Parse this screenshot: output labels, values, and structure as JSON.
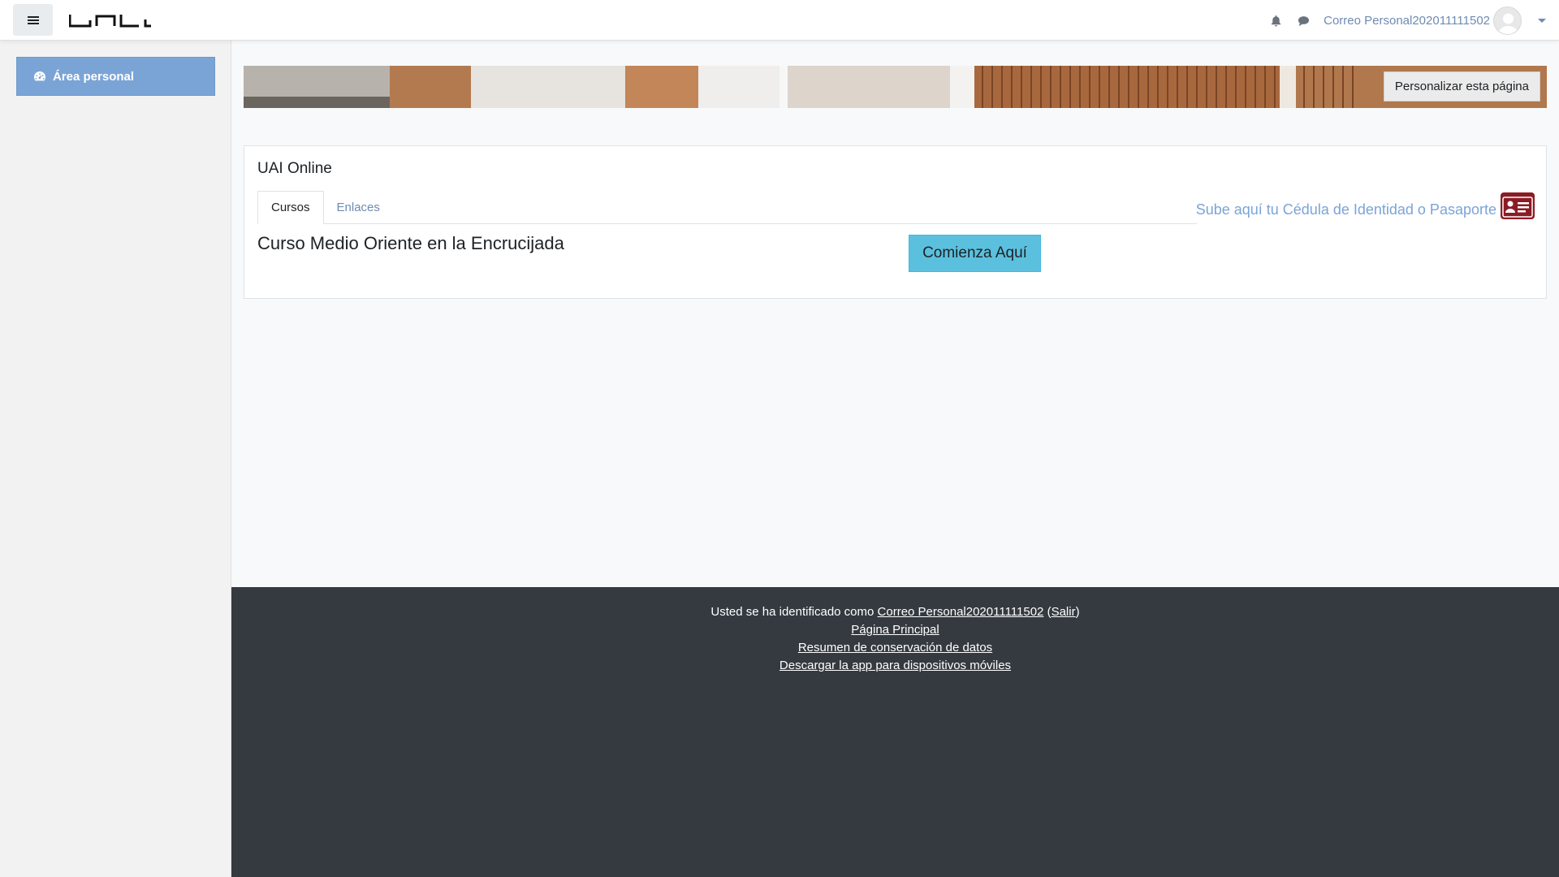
{
  "navbar": {
    "menu_label": "Menu",
    "notifications_icon": "bell-icon",
    "messages_icon": "comment-icon",
    "user_name": "Correo Personal202011111502"
  },
  "sidebar": {
    "items": [
      {
        "label": "Área personal",
        "icon": "dashboard-icon"
      }
    ]
  },
  "main": {
    "customize_button": "Personalizar esta página",
    "block_title": "UAI Online",
    "tabs": [
      {
        "label": "Cursos",
        "active": true
      },
      {
        "label": "Enlaces",
        "active": false
      }
    ],
    "id_upload_link": "Sube aquí tu Cédula de Identidad o Pasaporte",
    "course_title": "Curso Medio Oriente en la Encrucijada",
    "start_button": "Comienza Aquí"
  },
  "footer": {
    "logged_in_prefix": "Usted se ha identificado como",
    "user_link": "Correo Personal202011111502",
    "logout_link": "Salir",
    "home_link": "Página Principal",
    "data_retention_link": "Resumen de conservación de datos",
    "mobile_app_link": "Descargar la app para dispositivos móviles"
  },
  "colors": {
    "sidebar_active": "#7ba4d6",
    "link": "#6e8bb2",
    "start_button": "#5bc0de",
    "footer_bg": "#343a40",
    "id_icon": "#8c1c24"
  }
}
